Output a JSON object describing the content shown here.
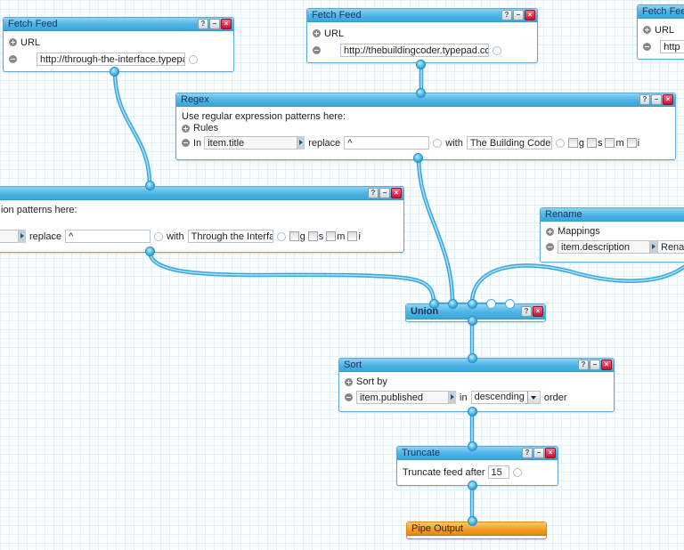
{
  "modules": {
    "fetch1": {
      "title": "Fetch Feed",
      "section_label": "URL",
      "url": "http://through-the-interface.typepa"
    },
    "fetch2": {
      "title": "Fetch Feed",
      "section_label": "URL",
      "url": "http://thebuildingcoder.typepad.co"
    },
    "fetch3": {
      "title": "Fetch Fee",
      "section_label": "URL",
      "url": "http"
    },
    "regex1": {
      "title": "Regex",
      "description": "Use regular expression patterns here:",
      "section_label": "Rules",
      "in_label": "In",
      "field": "item.title",
      "replace_label": "replace",
      "pattern": "^",
      "with_label": "with",
      "replacement": "The Building Code",
      "flags": [
        "g",
        "s",
        "m",
        "i"
      ]
    },
    "regex2": {
      "description": "ion patterns here:",
      "replace_label": "replace",
      "pattern": "^",
      "with_label": "with",
      "replacement": "Through the Interfa",
      "flags": [
        "g",
        "s",
        "m",
        "i"
      ]
    },
    "rename": {
      "title": "Rename",
      "section_label": "Mappings",
      "field": "item.description",
      "target": "Rena"
    },
    "union": {
      "title": "Union"
    },
    "sort": {
      "title": "Sort",
      "section_label": "Sort by",
      "field": "item.published",
      "in_label": "in",
      "order_value": "descending",
      "order_label": "order"
    },
    "truncate": {
      "title": "Truncate",
      "label": "Truncate feed after",
      "count": "15"
    },
    "output": {
      "title": "Pipe Output"
    }
  },
  "controls": {
    "help": "?",
    "minimize": "–",
    "close": "×"
  },
  "colors": {
    "wire": "#4db8e8",
    "header": "#4cb3e4",
    "output_header": "#f39a1c"
  }
}
